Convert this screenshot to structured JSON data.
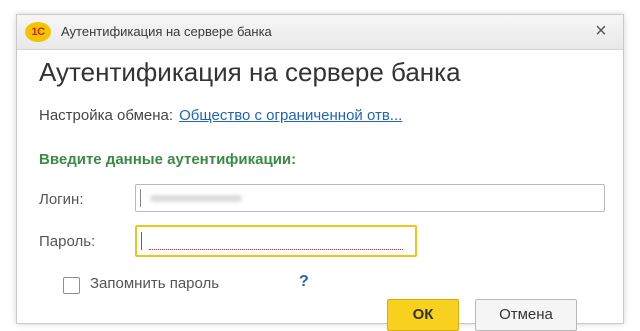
{
  "window": {
    "title": "Аутентификация на сервере банка",
    "app_logo_text": "1С",
    "close_glyph": "×"
  },
  "form": {
    "title": "Аутентификация на сервере банка",
    "exchange_label": "Настройка обмена:",
    "exchange_link": "Общество с ограниченной отв...",
    "section_header": "Введите данные аутентификации:",
    "login_label": "Логин:",
    "password_label": "Пароль:",
    "remember_label": "Запомнить пароль",
    "help_glyph": "?"
  },
  "buttons": {
    "ok": "ОК",
    "cancel": "Отмена"
  },
  "colors": {
    "accent_yellow": "#f7d11e",
    "focus_border": "#f0c419",
    "section_green": "#3b8a47",
    "link_blue": "#1f64b8"
  },
  "icons": {
    "app": "1c-logo-icon",
    "close": "close-icon",
    "help": "help-icon"
  }
}
